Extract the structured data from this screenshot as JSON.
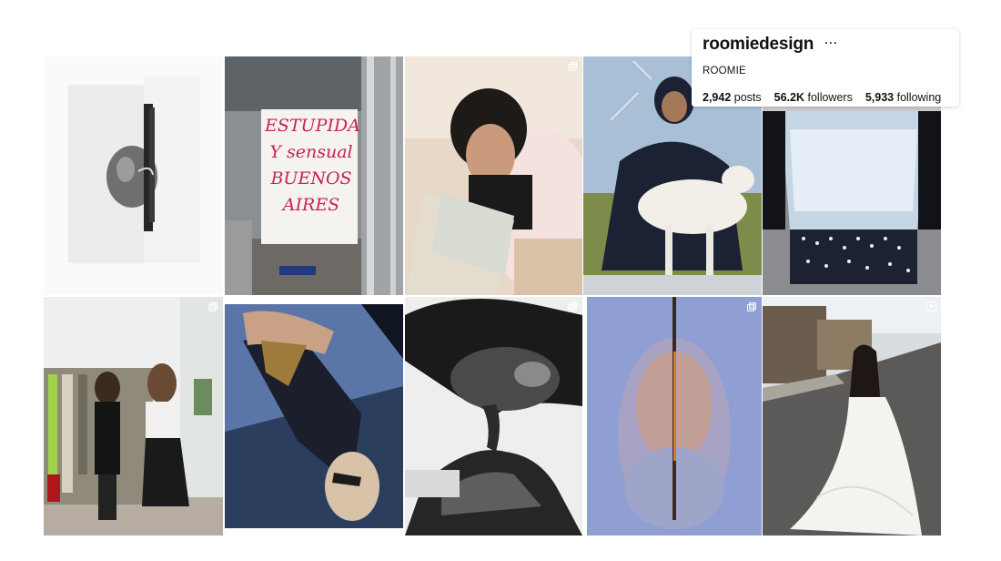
{
  "profile": {
    "username": "roomiedesign",
    "more_icon": "more-options-icon",
    "full_name": "ROOMIE",
    "posts": {
      "count": "2,942",
      "label": "posts"
    },
    "followers": {
      "count": "56.2K",
      "label": "followers"
    },
    "following": {
      "count": "5,933",
      "label": "following"
    }
  },
  "grid": {
    "posts": [
      {
        "id": "p1",
        "handwriting": ""
      },
      {
        "id": "p2",
        "handwriting_lines": [
          "ESTUPIDA",
          "Y sensual",
          "BUENOS",
          "AIRES"
        ]
      },
      {
        "id": "p3",
        "badge": "multi-image-icon"
      },
      {
        "id": "p4"
      },
      {
        "id": "p5"
      },
      {
        "id": "p6",
        "badge": "multi-image-icon"
      },
      {
        "id": "p7"
      },
      {
        "id": "p8",
        "badge": "multi-image-icon"
      },
      {
        "id": "p9",
        "badge": "multi-image-icon"
      },
      {
        "id": "p10",
        "badge": "reel-icon"
      }
    ]
  },
  "colors": {
    "background": "#ffffff",
    "text": "#111111",
    "handwriting": "#c8244f"
  }
}
